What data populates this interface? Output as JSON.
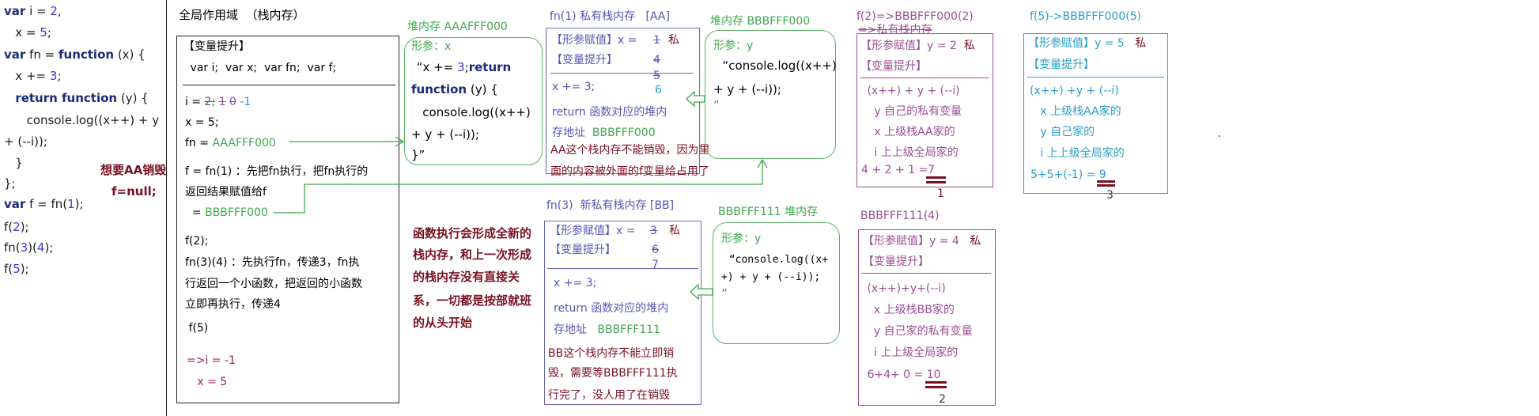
{
  "code": [
    [
      {
        "t": "var",
        "k": "kw"
      },
      {
        "t": " i = "
      },
      {
        "t": "2",
        "k": "num"
      },
      {
        "t": ","
      }
    ],
    [
      {
        "t": "   x = "
      },
      {
        "t": "5",
        "k": "num"
      },
      {
        "t": ";"
      }
    ],
    [
      {
        "t": "var",
        "k": "kw"
      },
      {
        "t": " fn = "
      },
      {
        "t": "function",
        "k": "kw"
      },
      {
        "t": " (x) {"
      }
    ],
    [
      {
        "t": "   x += "
      },
      {
        "t": "3",
        "k": "num"
      },
      {
        "t": ";"
      }
    ],
    [
      {
        "t": "   "
      },
      {
        "t": "return function",
        "k": "kw"
      },
      {
        "t": " (y) {"
      }
    ],
    [
      {
        "t": "      console.log((x++) + y"
      }
    ],
    [
      {
        "t": "+ (--i));"
      }
    ],
    [
      {
        "t": "   }"
      }
    ],
    [
      {
        "t": "};"
      }
    ],
    [
      {
        "t": "var",
        "k": "kw"
      },
      {
        "t": " f = fn("
      },
      {
        "t": "1",
        "k": "num"
      },
      {
        "t": ");"
      }
    ],
    [
      {
        "t": "f("
      },
      {
        "t": "2",
        "k": "num"
      },
      {
        "t": ");"
      }
    ],
    [
      {
        "t": "fn("
      },
      {
        "t": "3",
        "k": "num"
      },
      {
        "t": ")("
      },
      {
        "t": "4",
        "k": "num"
      },
      {
        "t": ");"
      }
    ],
    [
      {
        "t": "f("
      },
      {
        "t": "5",
        "k": "num"
      },
      {
        "t": ");"
      }
    ]
  ],
  "note_destroy": {
    "line1": "想要AA销毁",
    "line2": "f=null;"
  },
  "global": {
    "title": "全局作用域  （栈内存）",
    "hoist_label": "【变量提升】",
    "hoist_vars": " var i;  var x;  var fn;  var f;",
    "i_line": {
      "prefix": "i = ",
      "v0": "2;",
      "v1": "1",
      "v2": "0",
      "v3": "-1"
    },
    "x_line": "x = 5;",
    "fn_line": {
      "prefix": "fn = ",
      "addr": "AAAFFF000"
    },
    "f_line1": "f = fn(1) ：先把fn执行，把fn执行的",
    "f_line2": "返回结果赋值给f",
    "f_line3": {
      "prefix": "  = ",
      "addr": "BBBFFF000"
    },
    "f2": "f(2);",
    "fn34_1": "fn(3)(4) ：先执行fn，传递3，fn执",
    "fn34_2": "行返回一个小函数，把返回的小函数",
    "fn34_3": "立即再执行，传递4",
    "f5": " f(5)",
    "result1": "=>i = -1",
    "result2": "   x = 5"
  },
  "heap_aaa": {
    "title": "堆内存 AAAFFF000",
    "param": "形参：x",
    "l1a": " “x += ",
    "l1b": "3",
    "l1c": ";",
    "l1d": "return",
    "l2a": "function",
    "l2b": " (y) {",
    "l3": "   console.log((x++)",
    "l4": "+ y + (--i));",
    "l5": "}”"
  },
  "stack_aa": {
    "title": "fn(1) 私有栈内存   [AA]",
    "param_label": "【形参赋值】",
    "param_x": "x = ",
    "x_vals": [
      "1",
      "4",
      "5",
      "6"
    ],
    "private": "私",
    "hoist_label": "【变量提升】",
    "stmt": "x += 3;",
    "ret1": "return 函数对应的堆内",
    "ret2_prefix": "存地址  ",
    "ret2_addr": "BBBFFF000",
    "note1": "AA这个栈内存不能销毁，因为里",
    "note2": "面的内容被外面的f变量给占用了"
  },
  "heap_bbb000": {
    "title": "堆内存 BBBFFF000",
    "param": "形参：y",
    "l1": "  “console.log((x++)",
    "l2": "+ y + (--i));",
    "l3": "”"
  },
  "explain": [
    "函数执行会形成全新的",
    "栈内存，和上一次形成",
    "的栈内存没有直接关",
    "系，一切都是按部就班",
    "的从头开始"
  ],
  "stack_bb": {
    "title": "fn(3)  新私有栈内存 [BB]",
    "param_label": "【形参赋值】",
    "param_x": "x = ",
    "x_vals": [
      "3",
      "6",
      "7"
    ],
    "private": "私",
    "hoist_label": "【变量提升】",
    "stmt": "x += 3;",
    "ret1": "return 函数对应的堆内",
    "ret2_prefix": "存地址   ",
    "ret2_addr": "BBBFFF111",
    "note1": "BB这个栈内存不能立即销",
    "note2": "毁，需要等BBBFFF111执",
    "note3": "行完了，没人用了在销毁"
  },
  "heap_bbb111": {
    "title": "BBBFFF111 堆内存",
    "param": "形参：y",
    "l1": " “console.log((x+",
    "l2": "+) + y + (--i));",
    "l3": "”"
  },
  "call_f2": {
    "title": "f(2)=>BBBFFF000(2)",
    "subtitle": "=>私有栈内存",
    "param": "【形参赋值】y = 2  ",
    "private": "私",
    "hoist_label": "【变量提升】",
    "expr": " (x++) + y + (--i)",
    "l1": "   y 自己的私有变量",
    "l2": "   x 上级栈AA家的",
    "l3": "   i 上上级全局家的",
    "calc": "4 + 2 + 1 =",
    "result": "7",
    "order": "1"
  },
  "call_f4": {
    "title": "BBBFFF111(4)",
    "param": "【形参赋值】y = 4   ",
    "private": "私",
    "hoist_label": "【变量提升】",
    "expr": " (x++)+y+(--i)",
    "l1": "  x 上级栈BB家的",
    "l2": "  y 自己家的私有变量",
    "l3": "  i 上上级全局家的",
    "calc": " 6+4+ 0 = ",
    "result": "10",
    "order": "2"
  },
  "call_f5": {
    "title": "f(5)->BBBFFF000(5)",
    "param": "【形参赋值】y = 5   ",
    "private": "私",
    "hoist_label": "【变量提升】",
    "expr": "(x++) +y + (--i)",
    "l1": "   x 上级栈AA家的",
    "l2": "   y 自己家的",
    "l3": "   i 上上级全局家的",
    "calc": "5+5+(-1) = ",
    "result": "9",
    "order": "3"
  },
  "colors": {
    "green": "#3fa84e",
    "dark_red": "#7a1020",
    "stack_blue": "#5656b8",
    "purple": "#9a4f93",
    "cyan": "#2b9ec8",
    "keyword": "#1c2a7a",
    "number": "#3b3bd0"
  }
}
